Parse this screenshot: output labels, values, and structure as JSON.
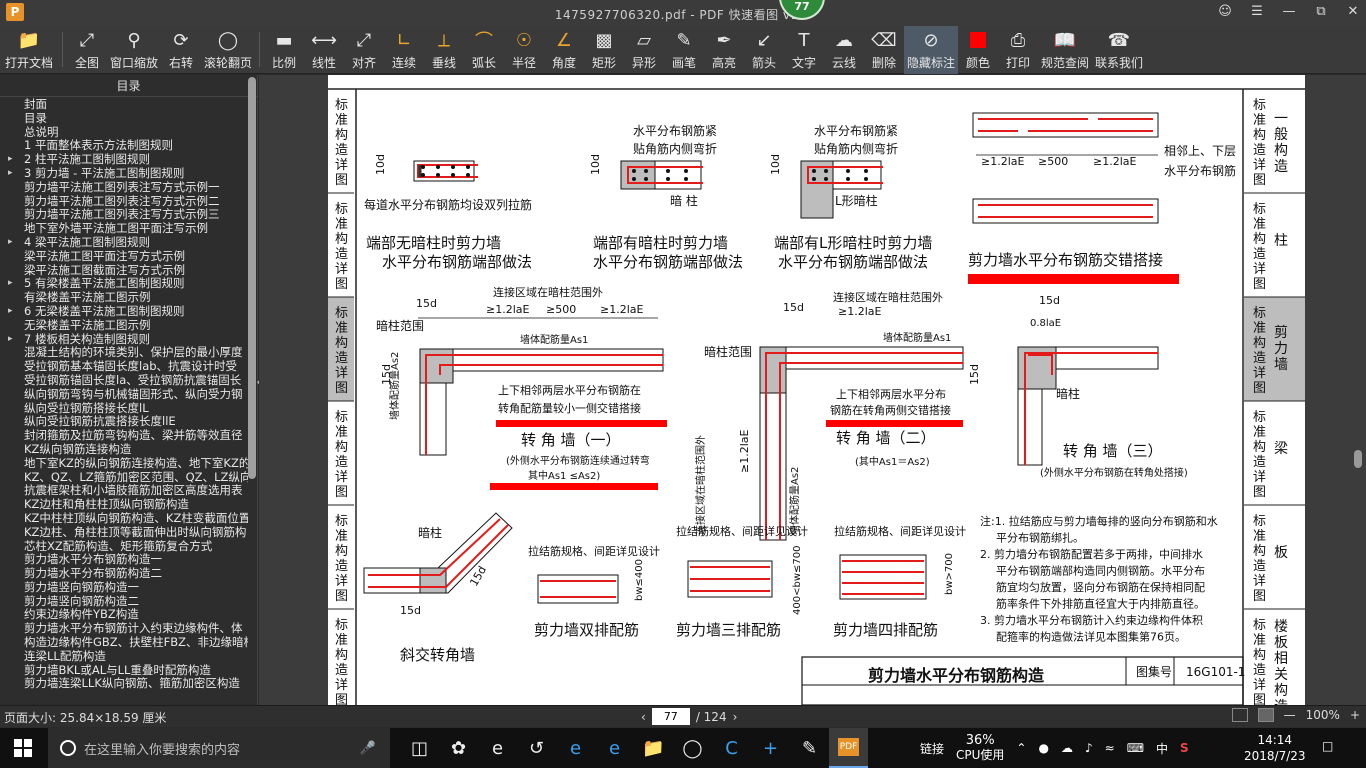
{
  "titlebar": {
    "app_logo": "P",
    "title": "1475927706320.pdf - PDF 快速看图 v1.9",
    "badge": "77",
    "controls": [
      "user-icon",
      "menu-icon",
      "minimize-icon",
      "restore-icon",
      "close-icon"
    ]
  },
  "toolbar": {
    "items": [
      {
        "label": "打开文档",
        "icon": "folder-icon"
      },
      {
        "label": "全图",
        "icon": "fit-icon"
      },
      {
        "label": "窗口缩放",
        "icon": "zoom-window-icon"
      },
      {
        "label": "右转",
        "icon": "rotate-right-icon"
      },
      {
        "label": "滚轮翻页",
        "icon": "mouse-wheel-icon"
      },
      {
        "label": "比例",
        "icon": "scale-icon"
      },
      {
        "label": "线性",
        "icon": "linear-measure-icon"
      },
      {
        "label": "对齐",
        "icon": "aligned-measure-icon"
      },
      {
        "label": "连续",
        "icon": "continuous-measure-icon"
      },
      {
        "label": "垂线",
        "icon": "perpendicular-icon"
      },
      {
        "label": "弧长",
        "icon": "arc-length-icon"
      },
      {
        "label": "半径",
        "icon": "radius-icon"
      },
      {
        "label": "角度",
        "icon": "angle-icon"
      },
      {
        "label": "矩形",
        "icon": "rectangle-area-icon"
      },
      {
        "label": "异形",
        "icon": "polygon-area-icon"
      },
      {
        "label": "画笔",
        "icon": "pen-icon"
      },
      {
        "label": "高亮",
        "icon": "highlighter-icon"
      },
      {
        "label": "箭头",
        "icon": "arrow-icon"
      },
      {
        "label": "文字",
        "icon": "text-icon"
      },
      {
        "label": "云线",
        "icon": "cloud-line-icon"
      },
      {
        "label": "删除",
        "icon": "eraser-icon"
      },
      {
        "label": "隐藏标注",
        "icon": "hide-markup-icon"
      },
      {
        "label": "颜色",
        "icon": "color-swatch-icon"
      },
      {
        "label": "打印",
        "icon": "printer-icon"
      },
      {
        "label": "规范查阅",
        "icon": "book-icon"
      },
      {
        "label": "联系我们",
        "icon": "contact-icon"
      }
    ],
    "active_color": "#ff0000"
  },
  "sidebar": {
    "title": "目录",
    "items": [
      {
        "label": "封面",
        "arrow": ""
      },
      {
        "label": "目录",
        "arrow": ""
      },
      {
        "label": "总说明",
        "arrow": ""
      },
      {
        "label": "1 平面整体表示方法制图规则",
        "arrow": ""
      },
      {
        "label": "2 柱平法施工图制图规则",
        "arrow": "▸"
      },
      {
        "label": "3 剪力墙 - 平法施工图制图规则",
        "arrow": "▸"
      },
      {
        "label": "剪力墙平法施工图列表注写方式示例一",
        "arrow": ""
      },
      {
        "label": "剪力墙平法施工图列表注写方式示例二",
        "arrow": ""
      },
      {
        "label": "剪力墙平法施工图列表注写方式示例三",
        "arrow": ""
      },
      {
        "label": "地下室外墙平法施工图平面注写示例",
        "arrow": ""
      },
      {
        "label": "4 梁平法施工图制图规则",
        "arrow": "▸"
      },
      {
        "label": "梁平法施工图平面注写方式示例",
        "arrow": ""
      },
      {
        "label": "梁平法施工图截面注写方式示例",
        "arrow": ""
      },
      {
        "label": "5 有梁楼盖平法施工图制图规则",
        "arrow": "▸"
      },
      {
        "label": "有梁楼盖平法施工图示例",
        "arrow": ""
      },
      {
        "label": "6 无梁楼盖平法施工图制图规则",
        "arrow": "▸"
      },
      {
        "label": "无梁楼盖平法施工图示例",
        "arrow": ""
      },
      {
        "label": "7 楼板相关构造制图规则",
        "arrow": "▸"
      },
      {
        "label": "混凝土结构的环境类别、保护层的最小厚度",
        "arrow": ""
      },
      {
        "label": "受拉钢筋基本锚固长度lab、抗震设计时受",
        "arrow": ""
      },
      {
        "label": "受拉钢筋锚固长度la、受拉钢筋抗震锚固长",
        "arrow": ""
      },
      {
        "label": "纵向钢筋弯钩与机械锚固形式、纵向受力钢",
        "arrow": ""
      },
      {
        "label": "纵向受拉钢筋搭接长度lL",
        "arrow": ""
      },
      {
        "label": "纵向受拉钢筋抗震搭接长度llE",
        "arrow": ""
      },
      {
        "label": "封闭箍筋及拉筋弯钩构造、梁并筋等效直径",
        "arrow": ""
      },
      {
        "label": "KZ纵向钢筋连接构造",
        "arrow": ""
      },
      {
        "label": "地下室KZ的纵向钢筋连接构造、地下室KZ的",
        "arrow": ""
      },
      {
        "label": "KZ、QZ、LZ箍筋加密区范围、QZ、LZ纵向钢",
        "arrow": ""
      },
      {
        "label": "抗震框架柱和小墙肢箍筋加密区高度选用表",
        "arrow": ""
      },
      {
        "label": "KZ边柱和角柱柱顶纵向钢筋构造",
        "arrow": ""
      },
      {
        "label": "KZ中柱柱顶纵向钢筋构造、KZ柱变截面位置",
        "arrow": ""
      },
      {
        "label": "KZ边柱、角柱柱顶等截面伸出时纵向钢筋构",
        "arrow": ""
      },
      {
        "label": "芯柱XZ配筋构造、矩形箍筋复合方式",
        "arrow": ""
      },
      {
        "label": "剪力墙水平分布钢筋构造一",
        "arrow": ""
      },
      {
        "label": "剪力墙水平分布钢筋构造二",
        "arrow": ""
      },
      {
        "label": "剪力墙竖向钢筋构造一",
        "arrow": ""
      },
      {
        "label": "剪力墙竖向钢筋构造二",
        "arrow": ""
      },
      {
        "label": "约束边缘构件YBZ构造",
        "arrow": ""
      },
      {
        "label": "剪力墙水平分布钢筋计入约束边缘构件、体",
        "arrow": ""
      },
      {
        "label": "构造边缘构件GBZ、扶壁柱FBZ、非边缘暗柱",
        "arrow": ""
      },
      {
        "label": "连梁LL配筋构造",
        "arrow": ""
      },
      {
        "label": "剪力墙BKL或AL与LL重叠时配筋构造",
        "arrow": ""
      },
      {
        "label": "剪力墙连梁LLK纵向钢筋、箍筋加密区构造",
        "arrow": ""
      }
    ]
  },
  "document": {
    "left_tabs": [
      "标准构造详图",
      "标准构造详图",
      "标准构造详图",
      "标准构造详图",
      "标准构造详图",
      "标准构造详图"
    ],
    "right_tabs": [
      {
        "label": "标准构造详图",
        "section": "一般构造"
      },
      {
        "label": "标准构造详图",
        "section": "柱"
      },
      {
        "label": "标准构造详图",
        "section": "剪力墙"
      },
      {
        "label": "标准构造详图",
        "section": "梁"
      },
      {
        "label": "标准构造详图",
        "section": "板"
      },
      {
        "label": "标准构造详图",
        "section": "楼板相关构造"
      }
    ],
    "captions": {
      "end_no_column": [
        "端部无暗柱时剪力墙",
        "水平分布钢筋端部做法"
      ],
      "end_with_column": [
        "端部有暗柱时剪力墙",
        "水平分布钢筋端部做法"
      ],
      "end_l_column": [
        "端部有L形暗柱时剪力墙",
        "水平分布钢筋端部做法"
      ],
      "lap": "剪力墙水平分布钢筋交错搭接",
      "corner1": "转 角 墙（一）",
      "corner1_sub": "(外侧水平分布钢筋连续通过转弯",
      "corner1_sub2": "其中As1 ≤As2)",
      "corner2": "转 角 墙（二）",
      "corner2_sub": "(其中As1＝As2)",
      "corner3": "转 角 墙（三）",
      "corner3_sub": "(外侧水平分布钢筋在转角处搭接)",
      "oblique": "斜交转角墙",
      "double": "剪力墙双排配筋",
      "triple": "剪力墙三排配筋",
      "quad": "剪力墙四排配筋"
    },
    "labels": {
      "tie_each": "每道水平分布钢筋均设双列拉筋",
      "bend_tight": "水平分布钢筋紧",
      "bend_inner": "贴角筋内侧弯折",
      "dark_column": "暗 柱",
      "l_dark_column": "L形暗柱",
      "lap_adj": "相邻上、下层",
      "lap_bars": "水平分布钢筋",
      "lap_dims": [
        "≥1.2laE",
        "≥500",
        "≥1.2laE"
      ],
      "conn_zone": "连接区域在暗柱范围外",
      "dark_col_range": "暗柱范围",
      "wall_rebar_as1": "墙体配筋量As1",
      "wall_rebar_as2": "墙体配筋量As2",
      "c1_note1": "上下相邻两层水平分布钢筋在",
      "c1_note2": "转角配筋量较小一侧交错搭接",
      "c2_note1": "上下相邻两层水平分布",
      "c2_note2": "钢筋在转角两侧交错搭接",
      "tie_spec": "拉结筋规格、间距详见设计",
      "d15": "15d",
      "d10": "10d",
      "d08": "0.8laE",
      "dim12": "≥1.2laE",
      "bw400": "bw≤400",
      "bw700": "400<bw≤700",
      "bw700b": "bw>700",
      "dark_column2": "暗柱"
    },
    "notes": [
      "注:1. 拉结筋应与剪力墙每排的竖向分布钢筋和水",
      "平分布钢筋绑扎。",
      "2. 剪力墙分布钢筋配置若多于两排，中间排水",
      "平分布钢筋端部构造同内侧钢筋。水平分布",
      "筋宜均匀放置，竖向分布钢筋在保持相同配",
      "筋率条件下外排筋直径宜大于内排筋直径。",
      "3. 剪力墙水平分布钢筋计入约束边缘构件体积",
      "配箍率的构造做法详见本图集第76页。"
    ],
    "title_block": {
      "title": "剪力墙水平分布钢筋构造",
      "atlas_label": "图集号",
      "atlas_no": "16G101-1"
    },
    "highlight_color": "#ff0000"
  },
  "statusbar": {
    "page_size": "页面大小: 25.84×18.59 厘米",
    "current_page": "77",
    "total_pages": "/ 124",
    "zoom": "100%"
  },
  "taskbar": {
    "search_placeholder": "在这里输入你要搜索的内容",
    "tray_link": "链接",
    "cpu_percent": "36%",
    "cpu_label": "CPU使用",
    "ime": "中",
    "time": "14:14",
    "date": "2018/7/23"
  }
}
